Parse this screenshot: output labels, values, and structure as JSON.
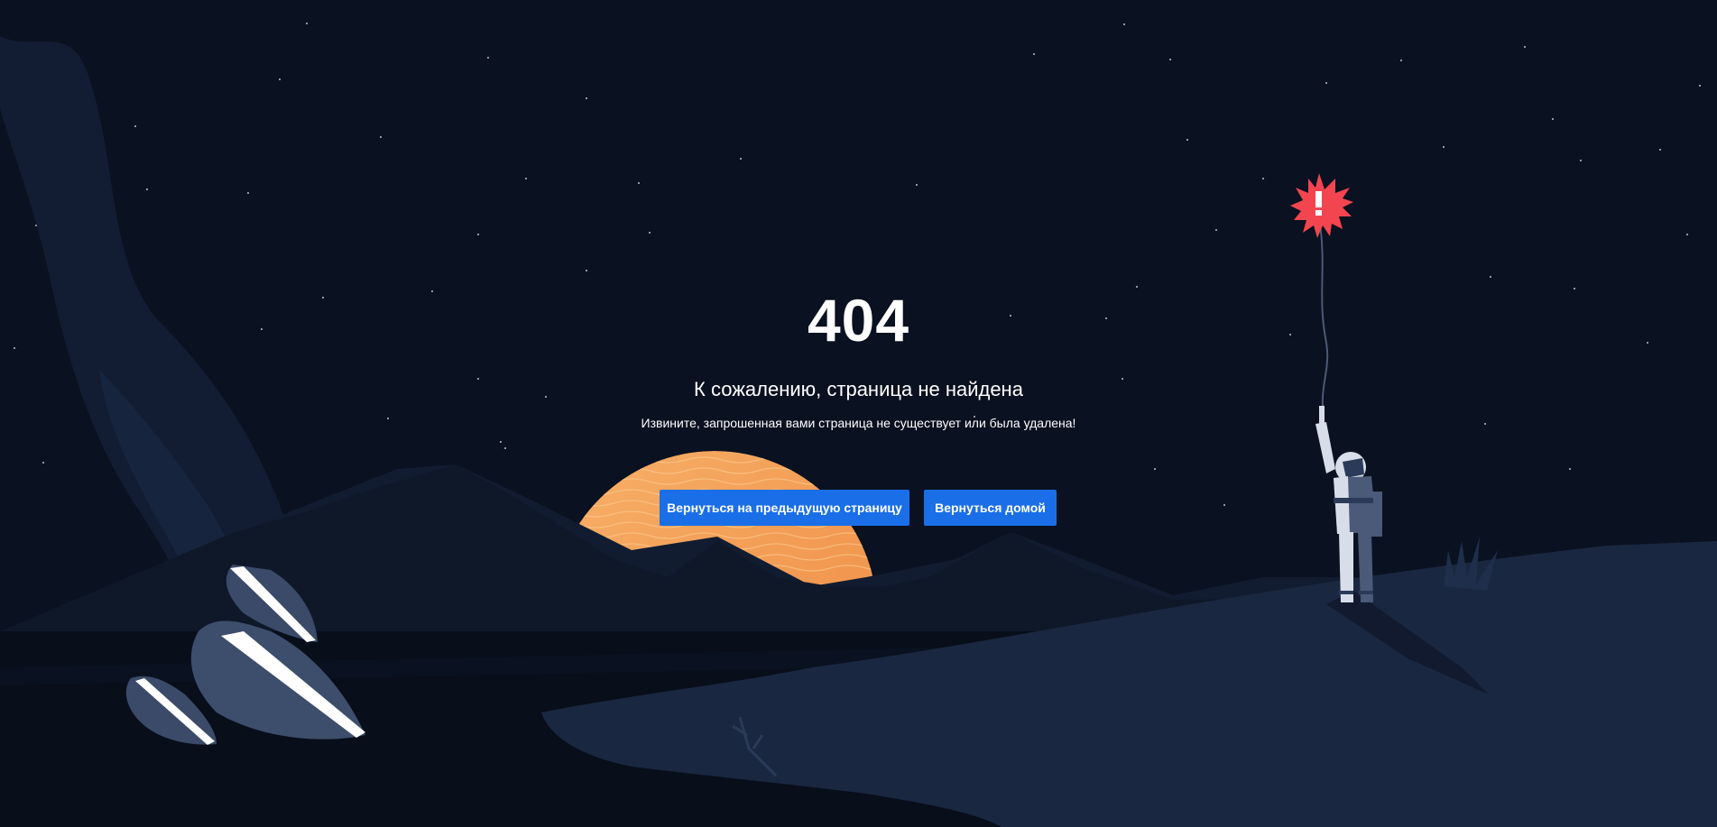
{
  "error": {
    "code": "404",
    "title": "К сожалению, страница не найдена",
    "message": "Извините, запрошенная вами страница не существует или была удалена!"
  },
  "actions": {
    "back_label": "Вернуться на предыдущую страницу",
    "home_label": "Вернуться домой"
  },
  "illustration": {
    "balloon_icon": "exclamation-icon",
    "colors": {
      "sky": "#0a1120",
      "sun": "#f29a52",
      "balloon": "#f2454f",
      "button": "#1a6fe8"
    }
  }
}
